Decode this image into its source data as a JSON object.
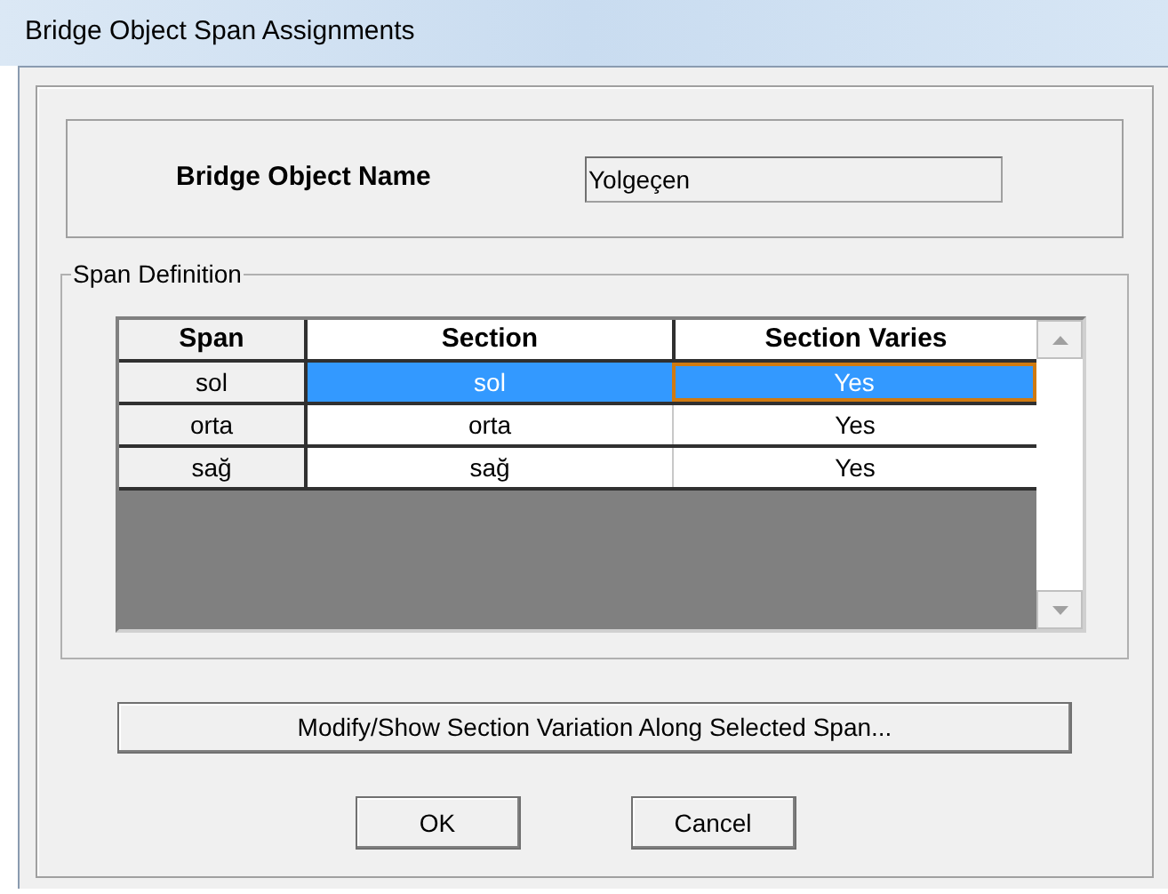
{
  "window": {
    "title": "Bridge Object Span Assignments"
  },
  "object_name": {
    "label": "Bridge Object Name",
    "value": "Yolgeçen"
  },
  "span_definition": {
    "title": "Span Definition",
    "columns": [
      "Span",
      "Section",
      "Section Varies"
    ],
    "rows": [
      {
        "span": "sol",
        "section": "sol",
        "varies": "Yes",
        "selected": true
      },
      {
        "span": "orta",
        "section": "orta",
        "varies": "Yes",
        "selected": false
      },
      {
        "span": "sağ",
        "section": "sağ",
        "varies": "Yes",
        "selected": false
      }
    ]
  },
  "buttons": {
    "modify": "Modify/Show Section Variation Along Selected Span...",
    "ok": "OK",
    "cancel": "Cancel"
  }
}
